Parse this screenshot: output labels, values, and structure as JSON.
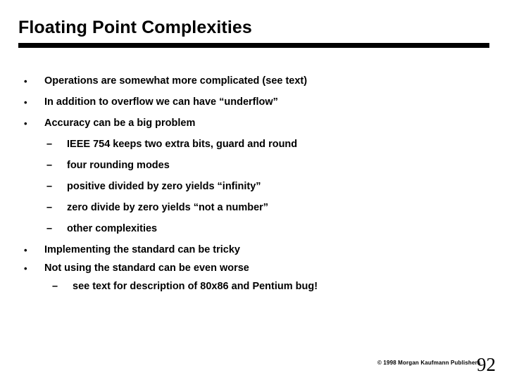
{
  "slide": {
    "title": "Floating Point Complexities",
    "bullets": [
      {
        "level": 1,
        "marker": "•",
        "text": "Operations are somewhat more complicated (see text)"
      },
      {
        "level": 1,
        "marker": "•",
        "text": "In addition to overflow we can have “underflow”"
      },
      {
        "level": 1,
        "marker": "•",
        "text": "Accuracy can be a big problem"
      },
      {
        "level": 2,
        "marker": "–",
        "text": "IEEE 754 keeps two extra bits, guard and round"
      },
      {
        "level": 2,
        "marker": "–",
        "text": "four rounding modes"
      },
      {
        "level": 2,
        "marker": "–",
        "text": "positive divided by zero yields “infinity”"
      },
      {
        "level": 2,
        "marker": "–",
        "text": "zero divide by zero yields “not a number”"
      },
      {
        "level": 2,
        "marker": "–",
        "text": "other complexities"
      },
      {
        "level": 1,
        "marker": "•",
        "text": "Implementing the standard can be tricky"
      },
      {
        "level": 1,
        "marker": "•",
        "text": "Not using the standard can be even worse"
      },
      {
        "level": 2,
        "marker": "–",
        "text": "see text for description of 80x86 and Pentium bug!"
      }
    ],
    "footer": {
      "copyright": "© 1998 Morgan Kaufmann Publishers",
      "page_number": "92"
    },
    "colors": {
      "background": "#ffffff",
      "text": "#000000",
      "rule": "#000000"
    }
  }
}
